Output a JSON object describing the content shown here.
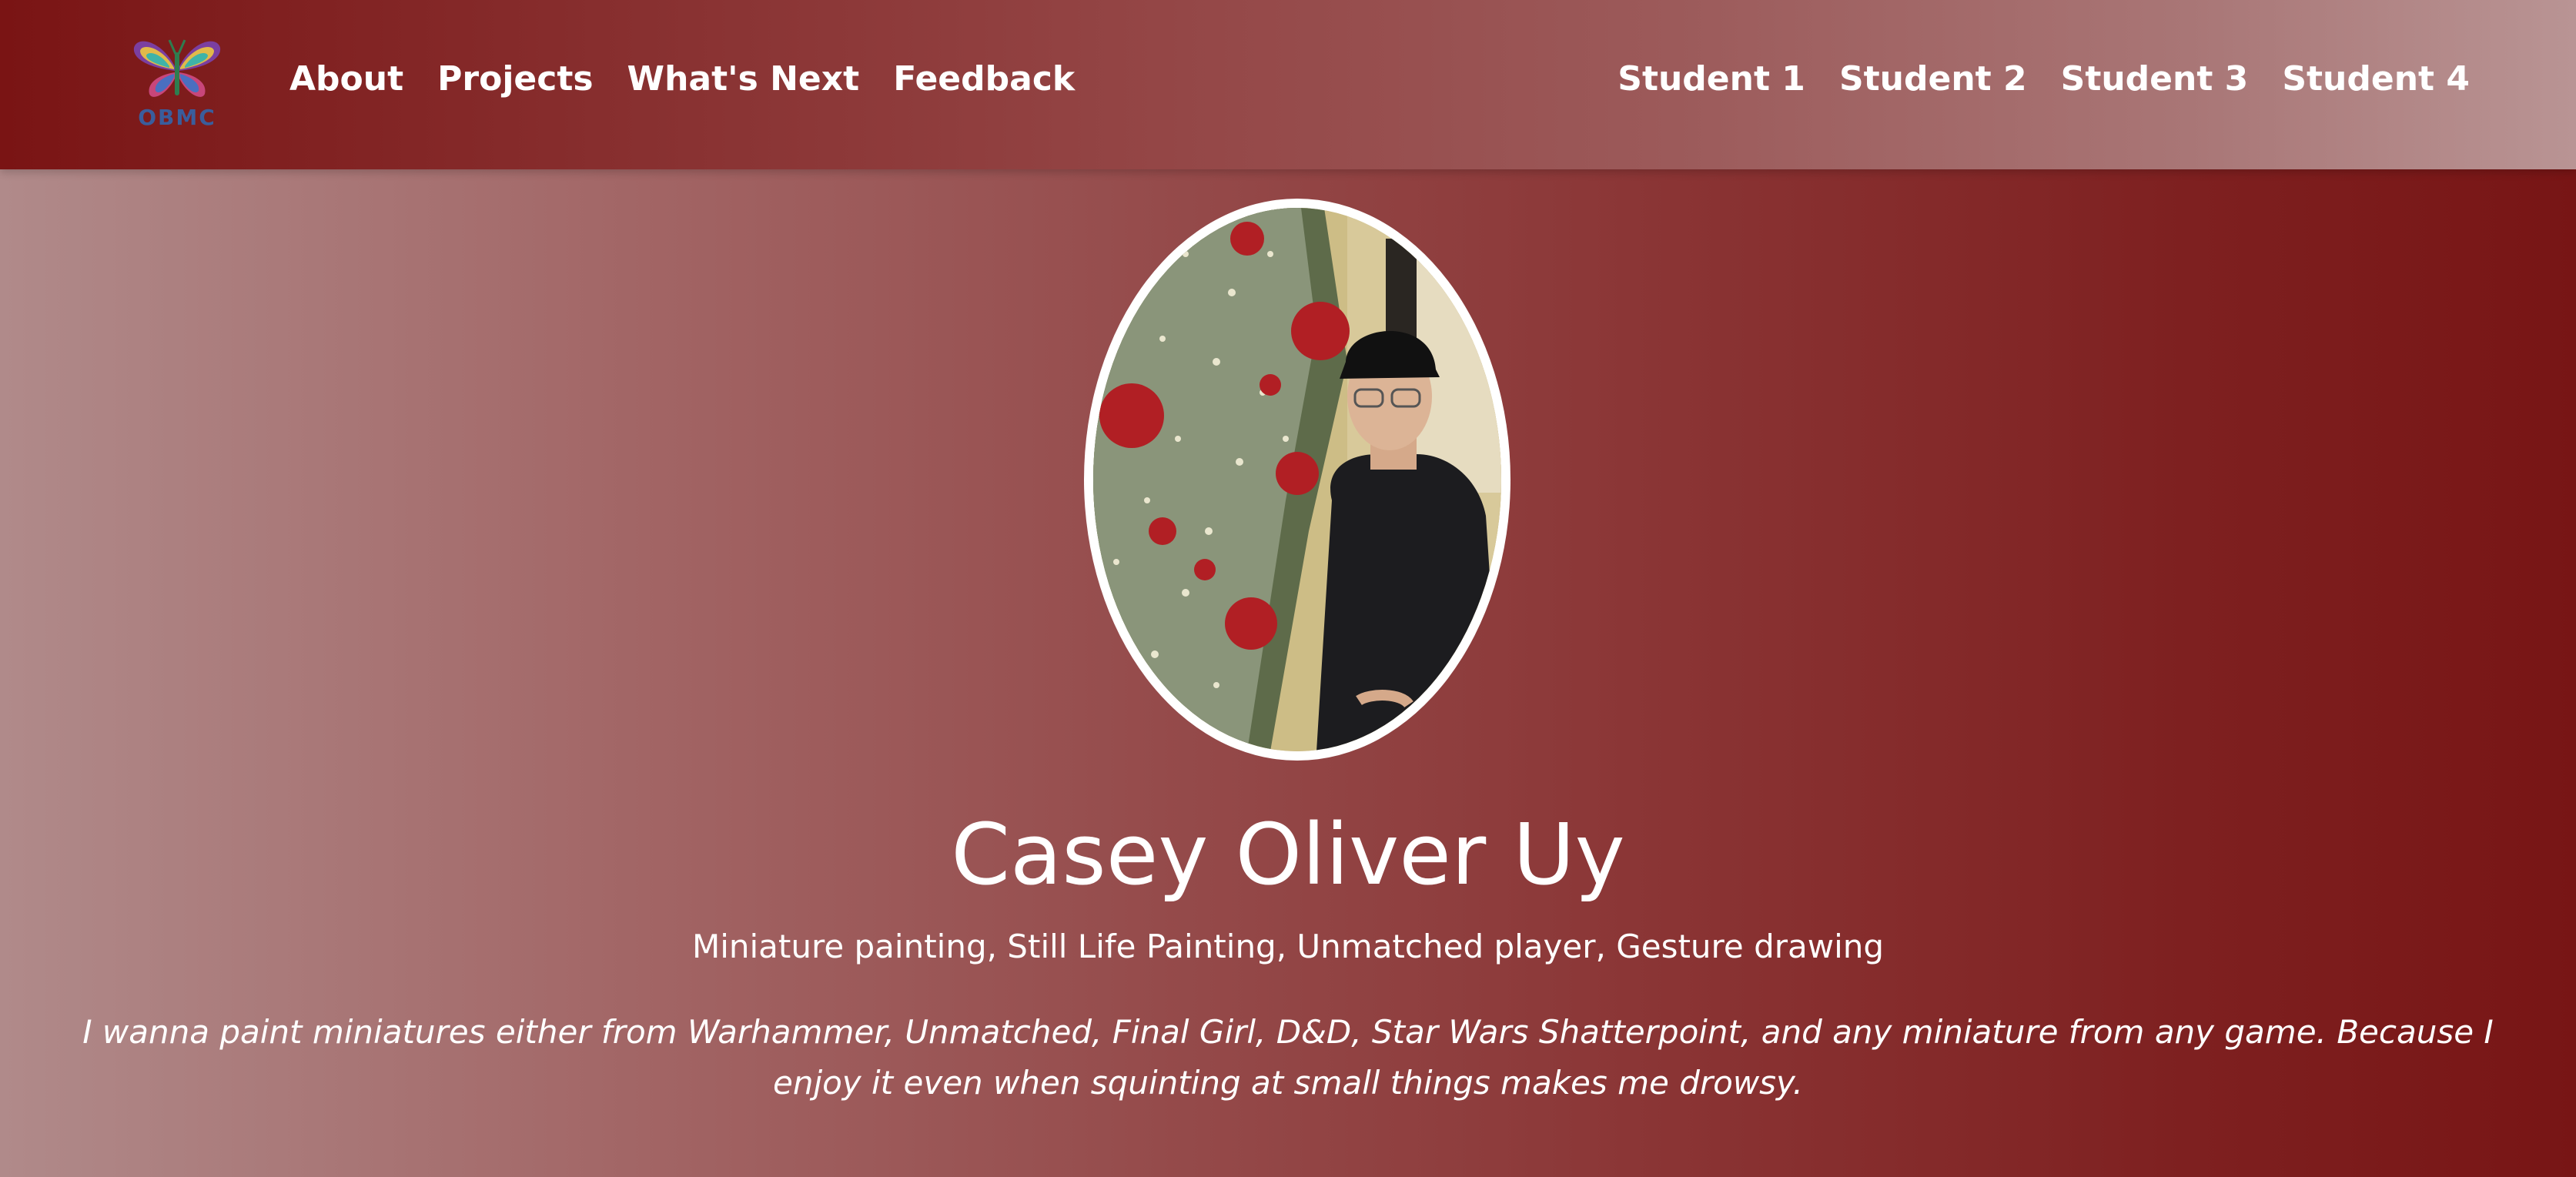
{
  "logo": {
    "text": "OBMC",
    "icon": "butterfly-icon"
  },
  "nav_left": [
    "About",
    "Projects",
    "What's Next",
    "Feedback"
  ],
  "nav_right": [
    "Student 1",
    "Student 2",
    "Student 3",
    "Student 4"
  ],
  "profile": {
    "name": "Casey Oliver Uy",
    "hobbies": "Miniature painting, Still Life Painting, Unmatched player, Gesture drawing",
    "bio": "I wanna paint miniatures either from Warhammer, Unmatched, Final Girl, D&D, Star Wars Shatterpoint, and any miniature from any game. Because I enjoy it even when squinting at small things makes me drowsy."
  },
  "colors": {
    "header_left": "#7a1414",
    "header_right": "#b99494",
    "background_left": "#b08a8a",
    "background_right": "#781515",
    "text": "#ffffff",
    "logo_text": "#3a5d9c"
  }
}
